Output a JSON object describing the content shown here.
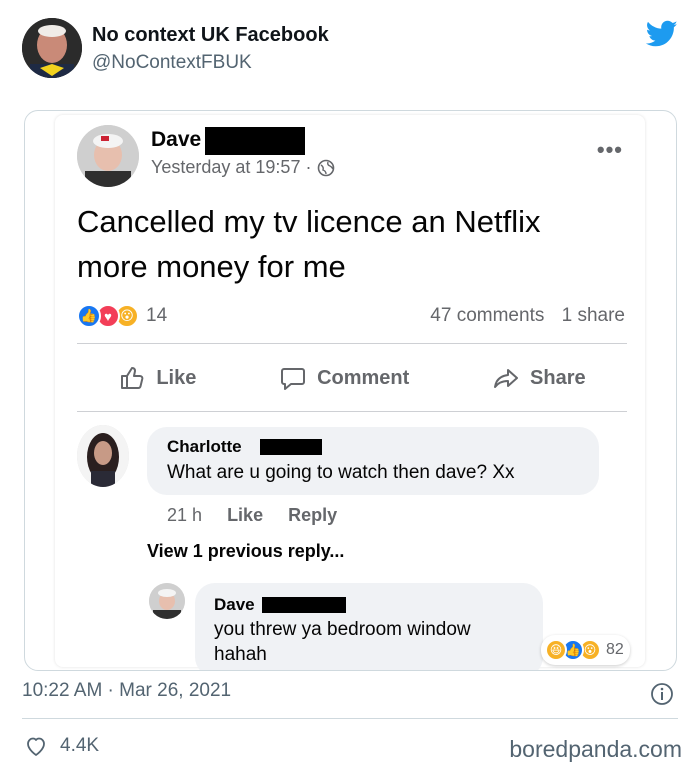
{
  "tweet": {
    "author_name": "No context UK Facebook",
    "handle": "@NoContextFBUK",
    "timestamp": "10:22 AM · Mar 26, 2021",
    "likes": "4.4K",
    "brand_color": "#1d9bf0"
  },
  "fb_post": {
    "author": "Dave",
    "time": "Yesterday at 19:57 ·",
    "text_line1": "Cancelled my tv licence an Netflix",
    "text_line2": "more money for me",
    "reaction_count": "14",
    "comments_count": "47 comments",
    "shares_count": "1 share",
    "actions": {
      "like": "Like",
      "comment": "Comment",
      "share": "Share"
    }
  },
  "comments": [
    {
      "author": "Charlotte",
      "text": "What are u going to watch then dave? Xx",
      "time": "21 h",
      "like_label": "Like",
      "reply_label": "Reply"
    }
  ],
  "view_replies": "View 1 previous reply...",
  "reply": {
    "author": "Dave",
    "text_line1": "you threw ya bedroom window",
    "text_line2": "hahah",
    "reaction_count": "82"
  },
  "watermark": "boredpanda.com"
}
